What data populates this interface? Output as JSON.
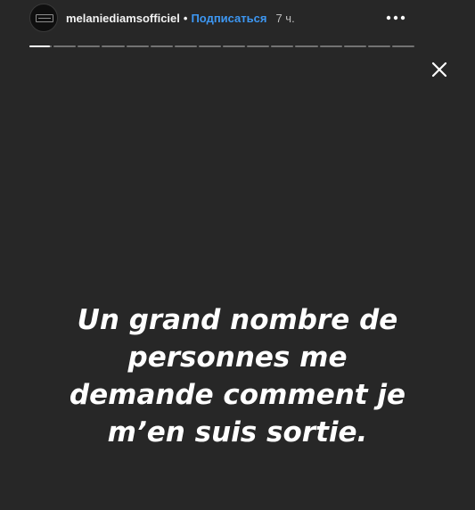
{
  "header": {
    "username": "melaniediamsofficiel",
    "separator": "•",
    "follow_label": "Подписаться",
    "time": "7 ч."
  },
  "icons": {
    "more": "more-horizontal-icon",
    "close": "close-icon"
  },
  "progress": {
    "segment_count": 16,
    "active_index": 0,
    "active_fraction": 0.9
  },
  "caption": {
    "lines": [
      "Un grand nombre de",
      "personnes me",
      "demande comment je",
      "m’en suis sortie."
    ]
  },
  "colors": {
    "background": "#272727",
    "follow": "#3d97f2",
    "text": "#ffffff"
  }
}
